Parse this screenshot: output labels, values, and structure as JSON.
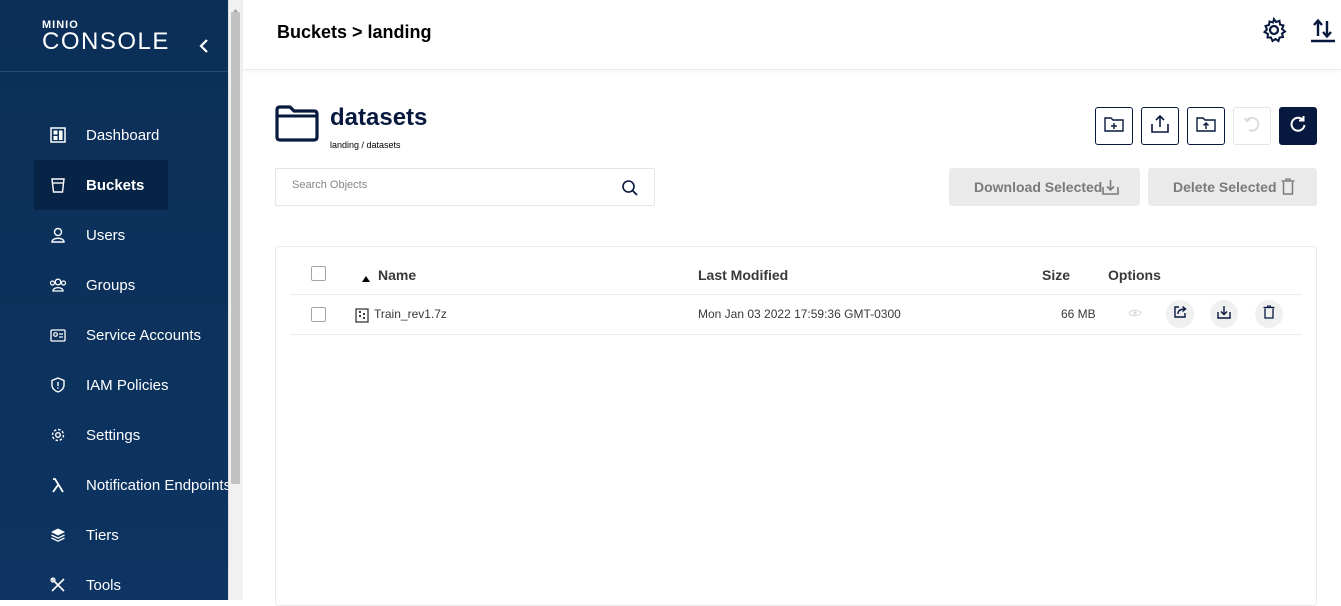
{
  "sidebar": {
    "logo_brand": "MINIO",
    "logo_product": "CONSOLE",
    "items": [
      {
        "label": "Dashboard",
        "icon": "dashboard-icon"
      },
      {
        "label": "Buckets",
        "icon": "bucket-icon",
        "active": true
      },
      {
        "label": "Users",
        "icon": "user-icon"
      },
      {
        "label": "Groups",
        "icon": "groups-icon"
      },
      {
        "label": "Service Accounts",
        "icon": "service-accounts-icon"
      },
      {
        "label": "IAM Policies",
        "icon": "shield-icon"
      },
      {
        "label": "Settings",
        "icon": "gear-icon"
      },
      {
        "label": "Notification Endpoints",
        "icon": "lambda-icon"
      },
      {
        "label": "Tiers",
        "icon": "layers-icon"
      },
      {
        "label": "Tools",
        "icon": "tools-icon"
      }
    ]
  },
  "header": {
    "breadcrumb": "Buckets > landing"
  },
  "object_header": {
    "title": "datasets",
    "path": "landing / datasets"
  },
  "search": {
    "placeholder": "Search Objects"
  },
  "toolbar": {
    "download_selected": "Download Selected",
    "delete_selected": "Delete Selected"
  },
  "table": {
    "columns": [
      "Name",
      "Last Modified",
      "Size",
      "Options"
    ],
    "rows": [
      {
        "name": "Train_rev1.7z",
        "last_modified": "Mon Jan 03 2022 17:59:36 GMT-0300",
        "size": "66 MB"
      }
    ]
  },
  "colors": {
    "sidebar_bg": "#0b2f57",
    "accent_dark": "#07193e",
    "disabled_btn_bg": "#eaeaea"
  }
}
